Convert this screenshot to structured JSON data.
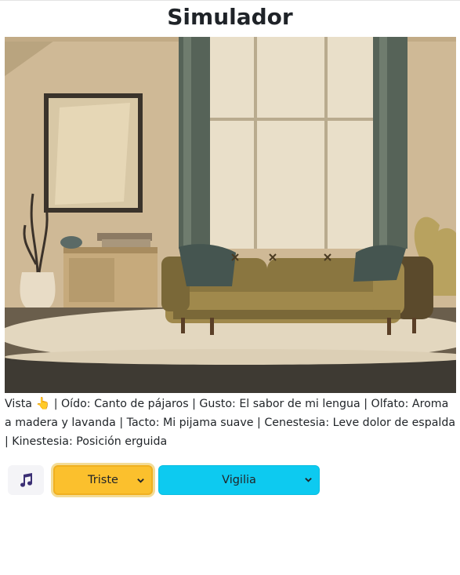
{
  "page": {
    "title": "Simulador"
  },
  "scene": {
    "image_name": "living-room-illustration",
    "colors": {
      "wall": "#cdb794",
      "sofa": "#8a7640",
      "curtain": "#4f5c50",
      "floor": "#3e3a33"
    }
  },
  "senses": {
    "vista_label": "Vista",
    "vista_icon": "pointing-hand-icon",
    "oido": "Oído: Canto de pájaros",
    "gusto": "Gusto: El sabor de mi lengua",
    "olfato": "Olfato: Aroma a madera y lavanda",
    "tacto": "Tacto: Mi pijama suave",
    "cenestesia": "Cenestesia: Leve dolor de espalda",
    "kinestesia": "Kinestesia: Posición erguida",
    "separator": " | "
  },
  "controls": {
    "music_icon": "music-note-icon",
    "mood_select": {
      "value": "Triste",
      "color": "#fbc02d"
    },
    "state_select": {
      "value": "Vigilia",
      "color": "#0dcaf0"
    }
  }
}
